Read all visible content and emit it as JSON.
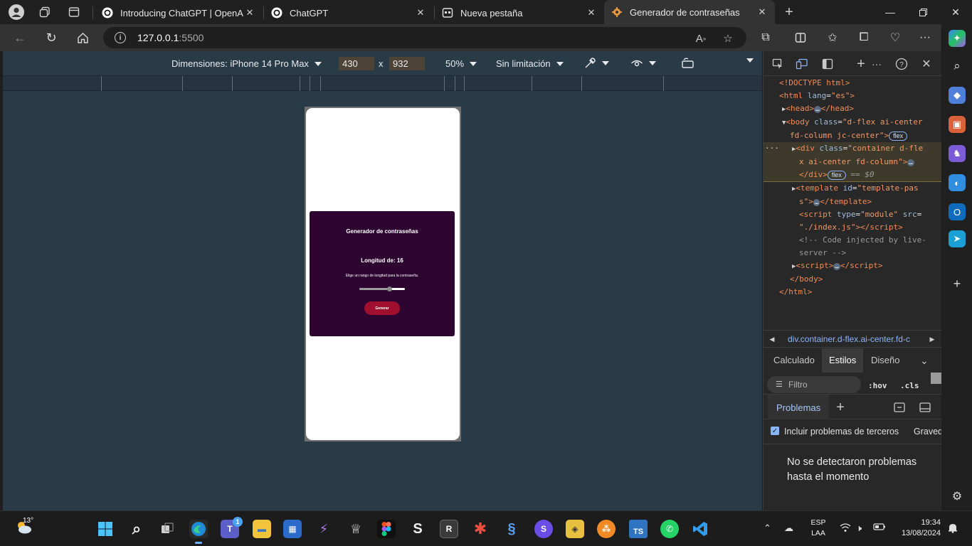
{
  "tabs": [
    {
      "title": "Introducing ChatGPT | OpenAI",
      "icon": "openai-icon"
    },
    {
      "title": "ChatGPT",
      "icon": "openai-icon"
    },
    {
      "title": "Nueva pestaña",
      "icon": "new-tab-icon"
    },
    {
      "title": "Generador de contraseñas",
      "icon": "settings-favicon-icon",
      "active": true
    }
  ],
  "address": {
    "host": "127.0.0.1",
    "port": ":5500"
  },
  "device_toolbar": {
    "dimensions_label": "Dimensiones: iPhone 14 Pro Max",
    "width": "430",
    "separator": "x",
    "height": "932",
    "zoom": "50%",
    "throttle": "Sin limitación"
  },
  "app": {
    "title": "Generador de contraseñas",
    "length_label": "Longitud de: 16",
    "hint": "Elige un rango de longitud para la contraseña.",
    "button": "Generar",
    "slider_fraction": 0.66,
    "card_color": "#2e0530",
    "button_color": "#a10f2e"
  },
  "dom": {
    "doctype": "<!DOCTYPE html>",
    "html_open_tag": "html",
    "html_lang_attr": "lang",
    "html_lang_value": "\"es\"",
    "head_tag": "head",
    "body_tag": "body",
    "body_class_attr": "class",
    "body_class_value_1": "\"d-flex ai-center",
    "body_class_value_2": "fd-column jc-center\"",
    "flex_badge": "flex",
    "div_tag": "div",
    "div_class_attr": "class",
    "div_class_value_1": "\"container d-fle",
    "div_class_value_2": "x ai-center fd-column\"",
    "selected_marker": "== $0",
    "template_tag": "template",
    "template_id_attr": "id",
    "template_id_value_1": "\"template-pas",
    "template_id_value_2": "s\"",
    "script_tag": "script",
    "script_type_attr": "type",
    "script_type_value": "\"module\"",
    "script_src_attr": "src",
    "script_src_value": "\"./index.js\"",
    "comment_1": "<!-- Code injected by live-",
    "comment_2": "server -->",
    "html_close_tag": "html",
    "ellipsis": "…"
  },
  "breadcrumb": "div.container.d-flex.ai-center.fd-c",
  "styles_tabs": [
    "Calculado",
    "Estilos",
    "Diseño"
  ],
  "styles_active_tab": "Estilos",
  "filter_placeholder": "Filtro",
  "hov": ":hov",
  "cls": ".cls",
  "drawer": {
    "tab": "Problemas",
    "include_third_party": "Incluir problemas de terceros",
    "severity": "Gravedad",
    "message": "No se detectaron problemas hasta el momento"
  },
  "taskbar": {
    "temperature": "13°",
    "teams_badge": "1",
    "lang_1": "ESP",
    "lang_2": "LAA",
    "time": "19:34",
    "date": "13/08/2024"
  }
}
